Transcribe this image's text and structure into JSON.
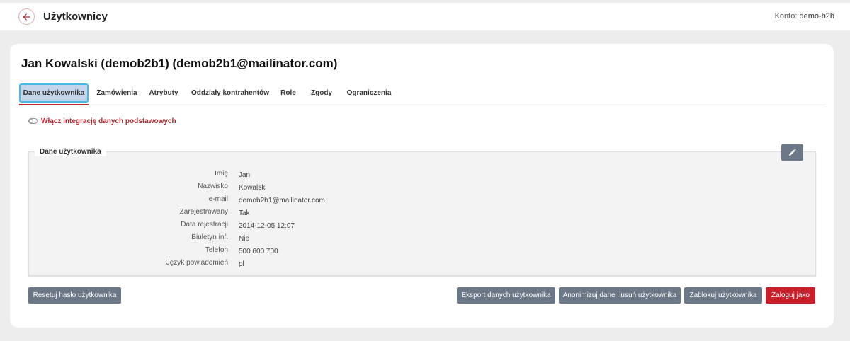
{
  "header": {
    "title": "Użytkownicy",
    "account_label": "Konto:",
    "account_value": "demo-b2b"
  },
  "user": {
    "heading": "Jan Kowalski (demob2b1) (demob2b1@mailinator.com)"
  },
  "tabs": [
    {
      "label": "Dane użytkownika",
      "active": true
    },
    {
      "label": "Zamówienia"
    },
    {
      "label": "Atrybuty"
    },
    {
      "label": "Oddziały kontrahentów"
    },
    {
      "label": "Role"
    },
    {
      "label": "Zgody"
    },
    {
      "label": "Ograniczenia"
    }
  ],
  "integration_toggle": {
    "label": "Włącz integrację danych podstawowych",
    "enabled": false
  },
  "panel": {
    "legend": "Dane użytkownika",
    "fields": [
      {
        "label": "Imię",
        "value": "Jan"
      },
      {
        "label": "Nazwisko",
        "value": "Kowalski"
      },
      {
        "label": "e-mail",
        "value": "demob2b1@mailinator.com"
      },
      {
        "label": "Zarejestrowany",
        "value": "Tak"
      },
      {
        "label": "Data rejestracji",
        "value": "2014-12-05 12:07"
      },
      {
        "label": "Biuletyn inf.",
        "value": "Nie"
      },
      {
        "label": "Telefon",
        "value": "500 600 700"
      },
      {
        "label": "Język powiadomień",
        "value": "pl"
      }
    ]
  },
  "actions": {
    "reset_password": "Resetuj hasło użytkownika",
    "export_data": "Eksport danych użytkownika",
    "anonymize": "Anonimizuj dane i usuń użytkownika",
    "block_user": "Zablokuj użytkownika",
    "login_as": "Zaloguj jako"
  },
  "icons": {
    "back": "arrow-left-icon",
    "edit": "pencil-icon",
    "toggle": "toggle-switch-icon"
  },
  "colors": {
    "accent_red": "#c0272d",
    "button_gray": "#6c7887",
    "active_tab_bg": "#c5d6ec",
    "active_tab_border": "#4ab7e4"
  }
}
